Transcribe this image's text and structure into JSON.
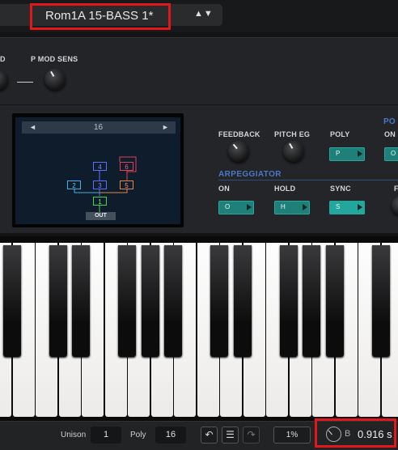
{
  "preset": {
    "name": "Rom1A 15-BASS 1*",
    "nav_arrows": "▲▼"
  },
  "controls_row1": {
    "partial_label": "D",
    "p_mod_sens_label": "P MOD SENS"
  },
  "fm_display": {
    "prev": "◄",
    "next": "►",
    "algorithm_number": "16",
    "operators": [
      "1",
      "2",
      "3",
      "4",
      "5",
      "6"
    ],
    "out_label": "OUT"
  },
  "fm_controls": {
    "feedback_label": "FEEDBACK",
    "pitch_eg_label": "PITCH EG",
    "poly_label": "POLY",
    "poly_button": "P",
    "po_partial_label": "PO",
    "po_on_label": "ON",
    "po_button": "O"
  },
  "arpeggiator": {
    "title": "ARPEGGIATOR",
    "on_label": "ON",
    "on_button": "O",
    "hold_label": "HOLD",
    "hold_button": "H",
    "sync_label": "SYNC",
    "sync_button": "S",
    "partial_label": "F"
  },
  "status_bar": {
    "unison_label": "Unison",
    "unison_value": "1",
    "poly_label": "Poly",
    "poly_value": "16",
    "undo_icon": "↶",
    "menu_icon": "☰",
    "redo_icon": "↷",
    "cpu_value": "1%",
    "time_prefix": "B",
    "time_value": "0.916 s"
  },
  "colors": {
    "teal_button": "#1f7f79",
    "arp_title": "#4a78c4",
    "highlight": "#e2161b",
    "op_blue": "#5b6cff",
    "op_cyan": "#35b6e6",
    "op_red": "#e0405a",
    "op_orange": "#e0864a",
    "op_green": "#3ed64a"
  }
}
